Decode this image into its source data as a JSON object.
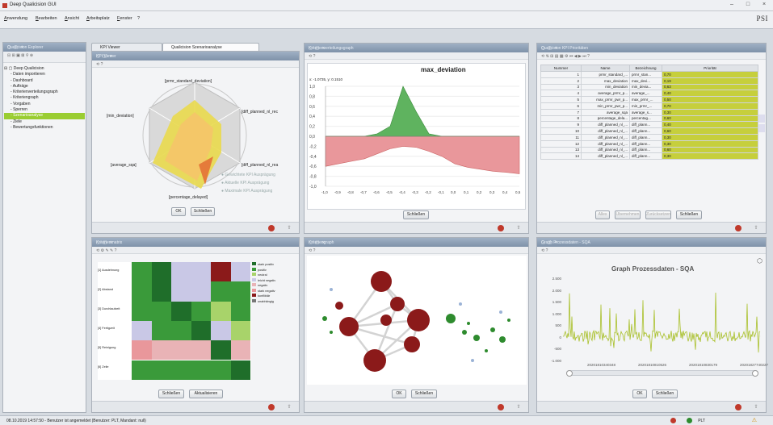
{
  "window": {
    "title": "Deep Qualicision GUI",
    "brand": "PSI"
  },
  "menu": [
    "Anwendung",
    "Bearbeiten",
    "Ansicht",
    "Arbeitsplatz",
    "Fenster",
    "?"
  ],
  "navigator": {
    "title": "Qualicision Explorer",
    "tree": [
      "Deep Qualicision",
      "Daten importieren",
      "Dashboard",
      "Aufträge",
      "Kriterienverteilungsgraph",
      "Kriteriengraph",
      "Vorgaben",
      "Sperren",
      "Szenarioanalyse",
      "Ziele",
      "Bewertungsfunktionen"
    ],
    "selected": "Szenarioanalyse"
  },
  "kpi": {
    "tabs": [
      "KPI Viewer",
      "Qualicision Szenarioanalyse"
    ],
    "title": "KPI Viewer",
    "axes": [
      "[prmr_standard_deviation]",
      "[diff_planned_nl_rec",
      "[diff_planned_nl_rea",
      "[percentage_delayed]",
      "[average_sqa]",
      "[min_deviation]"
    ],
    "legend": [
      "Gewichtete KPI Ausprägung",
      "Aktuelle KPI Ausprägung",
      "Maximale KPI Ausprägung"
    ],
    "ok": "OK",
    "close": "Schließen"
  },
  "chart_panel": {
    "title": "Kriterienverteilungsgraph",
    "chart_title": "max_deviation",
    "coord": "x: -1.0735, y: 0.1510",
    "close": "Schließen",
    "chart_data": {
      "type": "area",
      "title": "max_deviation",
      "x": [
        -1.0,
        -0.9,
        -0.8,
        -0.7,
        -0.6,
        -0.5,
        -0.4,
        -0.3,
        -0.2,
        -0.1,
        0.0,
        0.1,
        0.2,
        0.3,
        0.4,
        0.5
      ],
      "y_positive": [
        0,
        0,
        0,
        0,
        0.05,
        0.2,
        1.0,
        0.5,
        0.05,
        0,
        0,
        0,
        0,
        0,
        0,
        0
      ],
      "y_negative": [
        -0.6,
        -0.55,
        -0.5,
        -0.45,
        -0.35,
        -0.25,
        -0.2,
        -0.22,
        -0.3,
        -0.4,
        -0.55,
        -0.62,
        -0.66,
        -0.7,
        -0.72,
        -0.75
      ],
      "ylim": [
        -1.0,
        1.0
      ],
      "yticks": [
        "1,0",
        "0,8",
        "0,6",
        "0,4",
        "0,2",
        "0,0",
        "-0,2",
        "-0,4",
        "-0,6",
        "-0,8",
        "-1,0"
      ],
      "xticks": [
        "-1,0",
        "-0,9",
        "-0,8",
        "-0,7",
        "-0,6",
        "-0,5",
        "-0,4",
        "-0,3",
        "-0,2",
        "-0,1",
        "0,0",
        "0,1",
        "0,2",
        "0,3",
        "0,4",
        "0,5"
      ],
      "colors": {
        "positive": "#5fb35f",
        "negative": "#e9979b"
      }
    }
  },
  "table_panel": {
    "title": "Qualicision KPI Prioritäten",
    "headers": [
      "Nummer",
      "Name",
      "Bezeichnung",
      "Priorität"
    ],
    "rows": [
      [
        "1",
        "prmr_standard_...",
        "prmr_stan...",
        "0,70"
      ],
      [
        "2",
        "max_deviation",
        "max_devi...",
        "0,19"
      ],
      [
        "3",
        "min_deviation",
        "min_devia...",
        "0,63"
      ],
      [
        "4",
        "average_prmr_p...",
        "average_...",
        "0,40"
      ],
      [
        "5",
        "max_prmr_pwr_p...",
        "max_prmr_...",
        "0,50"
      ],
      [
        "6",
        "min_prmr_pwr_p...",
        "min_prmr_...",
        "0,70"
      ],
      [
        "7",
        "average_sqa",
        "average_s...",
        "0,30"
      ],
      [
        "8",
        "percentage_dela...",
        "percentag...",
        "0,60"
      ],
      [
        "9",
        "diff_planned_nl_...",
        "diff_plann...",
        "0,40"
      ],
      [
        "10",
        "diff_planned_nl_...",
        "diff_plann...",
        "0,60"
      ],
      [
        "11",
        "diff_planned_nl_...",
        "diff_plann...",
        "0,30"
      ],
      [
        "12",
        "diff_planned_nl_...",
        "diff_plann...",
        "0,30"
      ],
      [
        "13",
        "diff_planned_nl_...",
        "diff_plann...",
        "0,60"
      ],
      [
        "14",
        "diff_planned_nl_...",
        "diff_plann...",
        "0,30"
      ]
    ],
    "buttons": [
      "Alles",
      "Übernehmen",
      "Zurücksetzen",
      "Schließen"
    ]
  },
  "matrix_panel": {
    "title": "Kriterienmatrix",
    "rows": [
      "[1] Ausdehnung",
      "[2] Abstand",
      "[3] Durchlaufzeit",
      "[4] Fertigzeit",
      "[5] Reinigung",
      "[6] Zeile"
    ],
    "legend": [
      "stark positiv",
      "positiv",
      "neutral",
      "leicht negativ",
      "negativ",
      "stark negativ",
      "konfliktär",
      "unabhängig"
    ],
    "buttons": [
      "Schließen",
      "Aktualisieren"
    ]
  },
  "network_panel": {
    "title": "Kriteriengraph",
    "buttons": [
      "OK",
      "Schließen"
    ]
  },
  "graph_panel": {
    "title": "Graph Prozessdaten - SQA",
    "chart_title": "Graph Prozessdaten - SQA",
    "yticks": [
      "2.500",
      "2.000",
      "1.500",
      "1.000",
      "500",
      "0",
      "-500",
      "-1.000"
    ],
    "xticks": [
      "20201810340348",
      "20201810810526",
      "20201810830179",
      "20201827740227"
    ],
    "buttons": [
      "OK",
      "Schließen"
    ]
  },
  "status": {
    "text": "08.10.2019 14:57:50 - Benutzer ist angemeldet (Benutzer: PLT, Mandant: null)",
    "right": "PLT"
  }
}
